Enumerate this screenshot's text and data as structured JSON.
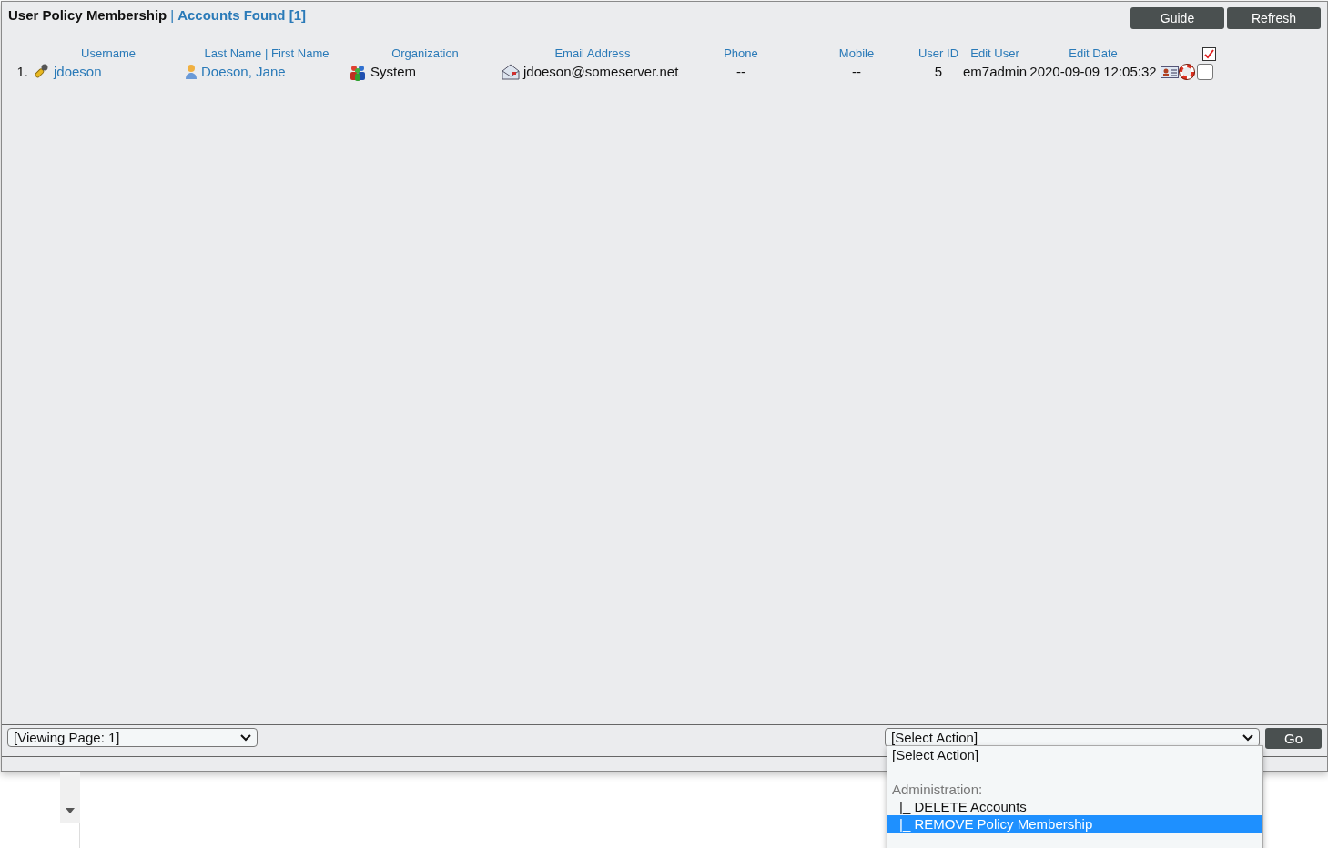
{
  "header": {
    "title": "User Policy Membership",
    "separator": "|",
    "found": "Accounts Found [1]"
  },
  "buttons": [
    "Guide",
    "Refresh"
  ],
  "columns": [
    "Username",
    "Last Name | First Name",
    "Organization",
    "Email Address",
    "Phone",
    "Mobile",
    "User ID",
    "Edit User",
    "Edit Date"
  ],
  "select_all": {
    "checked": true
  },
  "rows": [
    {
      "index": "1.",
      "username": "jdoeson",
      "name": "Doeson, Jane",
      "organization": "System",
      "email": "jdoeson@someserver.net",
      "phone": "--",
      "mobile": "--",
      "user_id": "5",
      "edit_user": "em7admin",
      "edit_date": "2020-09-09 12:05:32",
      "checked": false
    }
  ],
  "footer": {
    "page_select": "[Viewing Page: 1]",
    "action_select": "[Select Action]",
    "go": "Go"
  },
  "action_menu": [
    {
      "kind": "option",
      "label": "[Select Action]",
      "selected": false
    },
    {
      "kind": "spacer"
    },
    {
      "kind": "group",
      "label": "Administration:"
    },
    {
      "kind": "option",
      "label": "|_ DELETE Accounts",
      "selected": false
    },
    {
      "kind": "option",
      "label": "|_ REMOVE Policy Membership",
      "selected": true
    }
  ]
}
